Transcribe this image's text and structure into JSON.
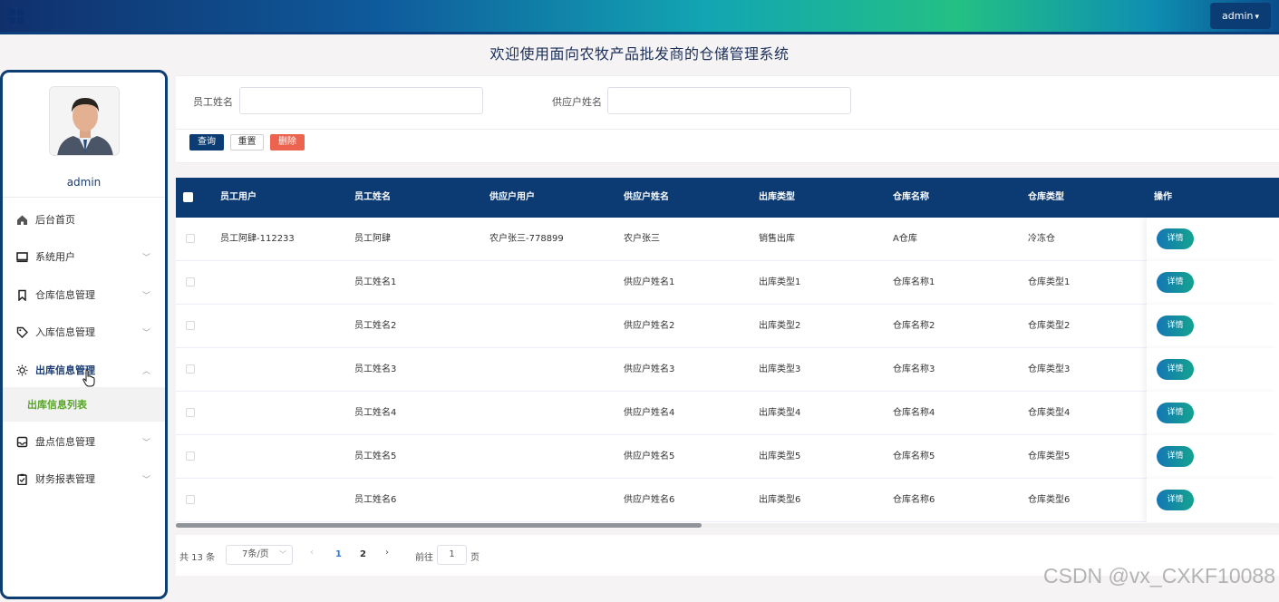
{
  "header": {
    "admin_label": "admin"
  },
  "system_title": "欢迎使用面向农牧产品批发商的仓储管理系统",
  "sidebar": {
    "username": "admin",
    "items": [
      {
        "label": "后台首页",
        "icon": "home-icon"
      },
      {
        "label": "系统用户",
        "icon": "monitor-icon"
      },
      {
        "label": "仓库信息管理",
        "icon": "bookmark-icon"
      },
      {
        "label": "入库信息管理",
        "icon": "tag-icon"
      },
      {
        "label": "出库信息管理",
        "icon": "sun-icon"
      },
      {
        "label": "盘点信息管理",
        "icon": "inbox-icon"
      },
      {
        "label": "财务报表管理",
        "icon": "clipboard-check-icon"
      }
    ],
    "sub_item": "出库信息列表"
  },
  "search": {
    "employee_name_label": "员工姓名",
    "supplier_name_label": "供应户姓名",
    "query_button": "查询",
    "reset_button": "重置",
    "delete_button": "删除"
  },
  "table": {
    "columns": [
      "员工用户",
      "员工姓名",
      "供应户用户",
      "供应户姓名",
      "出库类型",
      "仓库名称",
      "仓库类型",
      "操作"
    ],
    "rows": [
      [
        "员工阿肆-112233",
        "员工阿肆",
        "农户张三-778899",
        "农户张三",
        "销售出库",
        "A仓库",
        "冷冻仓"
      ],
      [
        "",
        "员工姓名1",
        "",
        "供应户姓名1",
        "出库类型1",
        "仓库名称1",
        "仓库类型1"
      ],
      [
        "",
        "员工姓名2",
        "",
        "供应户姓名2",
        "出库类型2",
        "仓库名称2",
        "仓库类型2"
      ],
      [
        "",
        "员工姓名3",
        "",
        "供应户姓名3",
        "出库类型3",
        "仓库名称3",
        "仓库类型3"
      ],
      [
        "",
        "员工姓名4",
        "",
        "供应户姓名4",
        "出库类型4",
        "仓库名称4",
        "仓库类型4"
      ],
      [
        "",
        "员工姓名5",
        "",
        "供应户姓名5",
        "出库类型5",
        "仓库名称5",
        "仓库类型5"
      ],
      [
        "",
        "员工姓名6",
        "",
        "供应户姓名6",
        "出库类型6",
        "仓库名称6",
        "仓库类型6"
      ]
    ],
    "detail_label": "详情"
  },
  "pagination": {
    "total": "共 13 条",
    "page_size": "7条/页",
    "pages": [
      "1",
      "2"
    ],
    "current_page": "1",
    "goto_label": "前往",
    "goto_value": "1",
    "page_suffix": "页"
  },
  "watermark": "CSDN @vx_CXKF10088",
  "colors": {
    "primary": "#0c3a72",
    "danger": "#ec6450",
    "accent_green": "#58a626"
  }
}
